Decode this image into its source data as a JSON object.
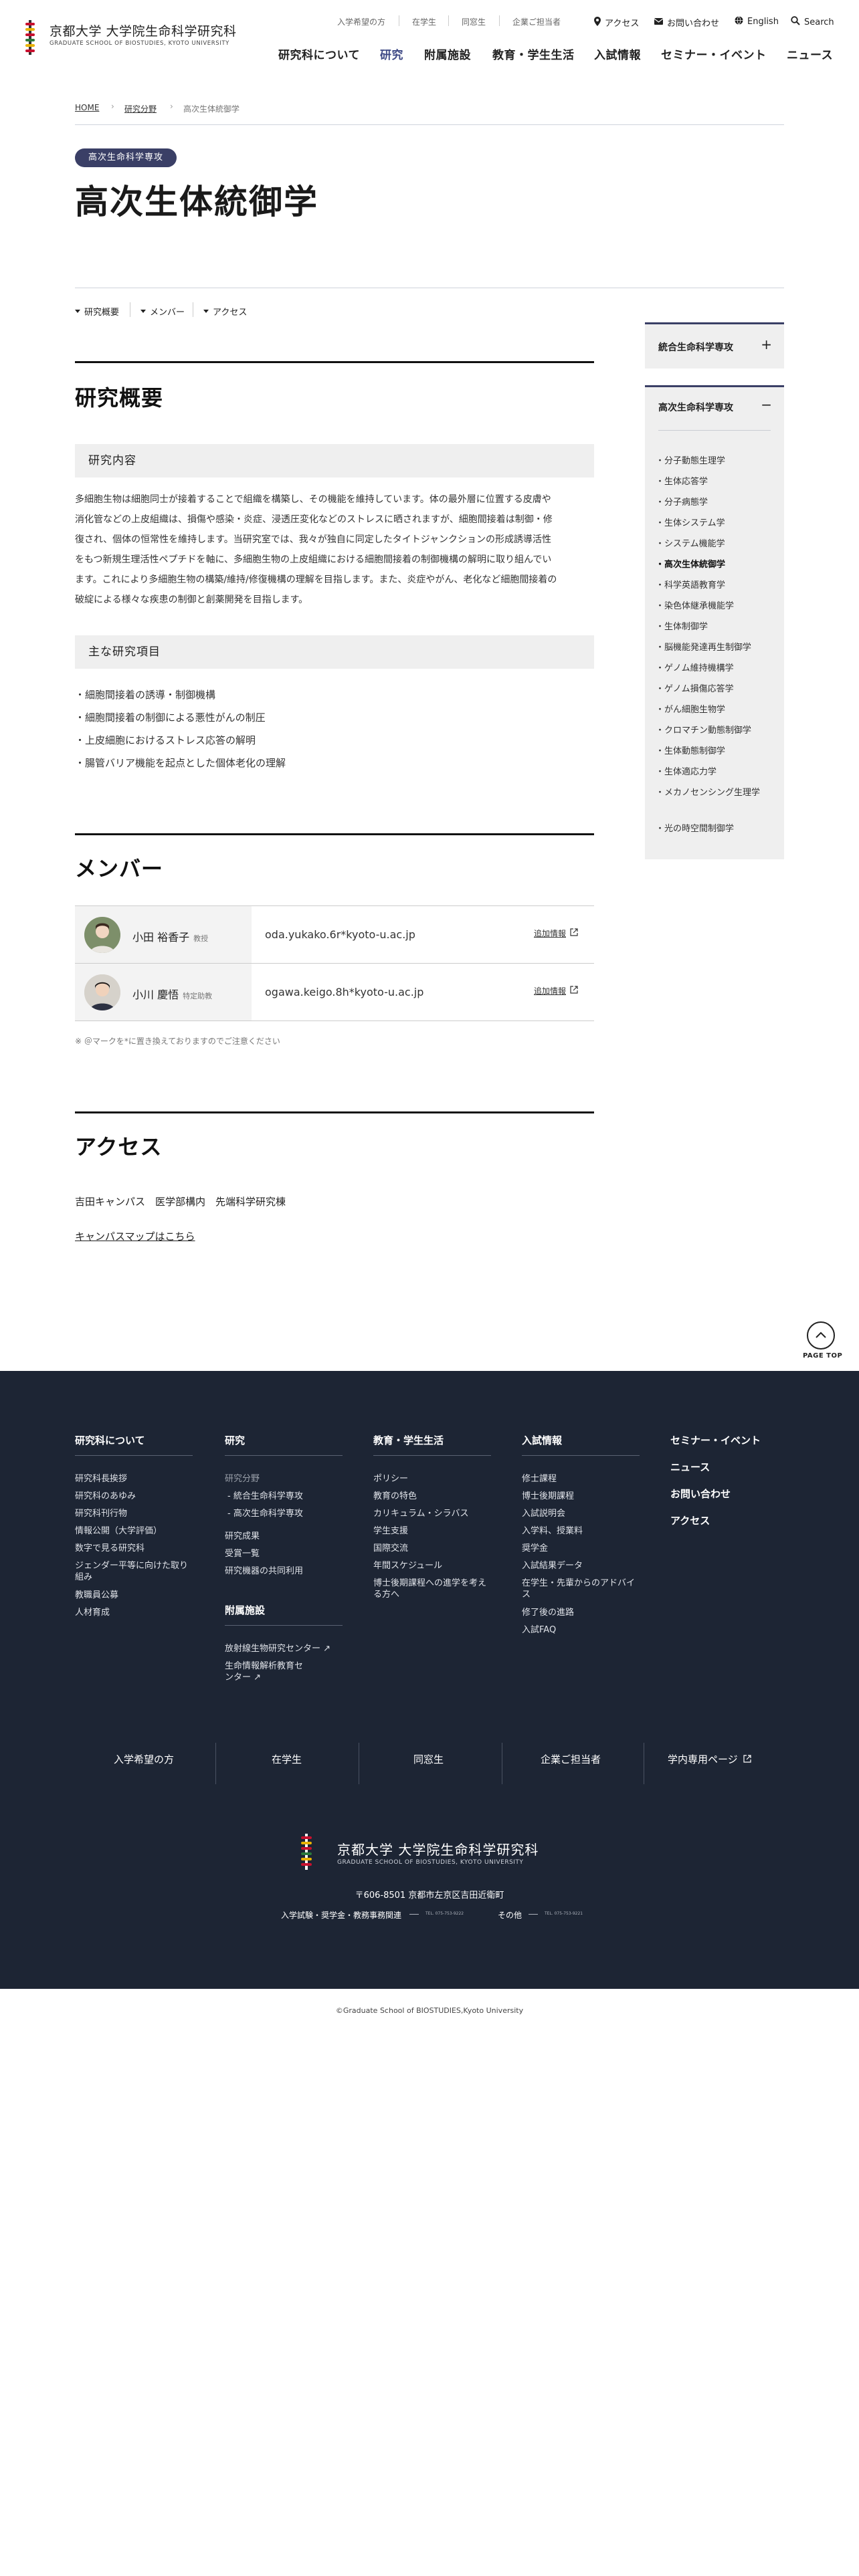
{
  "header": {
    "logo_jp": "京都大学 大学院生命科学研究科",
    "logo_en": "GRADUATE SCHOOL OF BIOSTUDIES, KYOTO UNIVERSITY",
    "utility_links": [
      "入学希望の方",
      "在学生",
      "同窓生",
      "企業ご担当者"
    ],
    "utility_actions": {
      "access": "アクセス",
      "contact": "お問い合わせ",
      "english": "English",
      "search": "Search"
    },
    "global_nav": [
      "研究科について",
      "研究",
      "附属施設",
      "教育・学生生活",
      "入試情報",
      "セミナー・イベント",
      "ニュース"
    ],
    "active_nav": "研究"
  },
  "breadcrumb": [
    "HOME",
    "研究分野",
    "高次生体統御学"
  ],
  "department_badge": "高次生命科学専攻",
  "page_title": "高次生体統御学",
  "anchor_links": [
    "研究概要",
    "メンバー",
    "アクセス"
  ],
  "overview": {
    "title": "研究概要",
    "content_heading": "研究内容",
    "content_lines": [
      "多細胞生物は細胞同士が接着することで組織を構築し、その機能を維持しています。体の最外層に位置する皮膚や",
      "消化管などの上皮組織は、損傷や感染・炎症、浸透圧変化などのストレスに晒されますが、細胞間接着は制御・修",
      "復され、個体の恒常性を維持します。当研究室では、我々が独自に同定したタイトジャンクションの形成誘導活性",
      "をもつ新規生理活性ペプチドを軸に、多細胞生物の上皮組織における細胞間接着の制御機構の解明に取り組んでい",
      "ます。これにより多細胞生物の構築/維持/修復機構の理解を目指します。また、炎症やがん、老化など細胞間接着の",
      "破綻による様々な疾患の制御と創薬開発を目指します。"
    ],
    "topics_heading": "主な研究項目",
    "topics": [
      "細胞間接着の誘導・制御機構",
      "細胞間接着の制御による悪性がんの制圧",
      "上皮細胞におけるストレス応答の解明",
      "腸管バリア機能を起点とした個体老化の理解"
    ]
  },
  "members": {
    "title": "メンバー",
    "rows": [
      {
        "name": "小田 裕香子",
        "role": "教授",
        "email": "oda.yukako.6r*kyoto-u.ac.jp",
        "link": "追加情報"
      },
      {
        "name": "小川 慶悟",
        "role": "特定助教",
        "email": "ogawa.keigo.8h*kyoto-u.ac.jp",
        "link": "追加情報"
      }
    ],
    "note": "※ ＠マークを*に置き換えておりますのでご注意ください"
  },
  "access": {
    "title": "アクセス",
    "location": "吉田キャンパス　医学部構内　先端科学研究棟",
    "map_link": "キャンパスマップはこちら"
  },
  "side_nav": {
    "collapsed_heading": "統合生命科学専攻",
    "expanded_heading": "高次生命科学専攻",
    "items": [
      "分子動態生理学",
      "生体応答学",
      "分子病態学",
      "生体システム学",
      "システム機能学",
      "高次生体統御学",
      "科学英語教育学",
      "染色体継承機能学",
      "生体制御学",
      "脳機能発達再生制御学",
      "ゲノム維持機構学",
      "ゲノム損傷応答学",
      "がん細胞生物学",
      "クロマチン動態制御学",
      "生体動態制御学",
      "生体適応力学",
      "メカノセンシング生理学",
      "光の時空間制御学"
    ],
    "active_item": "高次生体統御学"
  },
  "page_top": "PAGE TOP",
  "footer": {
    "columns": [
      {
        "heading": "研究科について",
        "links": [
          "研究科長挨拶",
          "研究科のあゆみ",
          "研究科刊行物",
          "情報公開（大学評価）",
          "数字で見る研究科",
          "ジェンダー平等に向けた取り組み",
          "教職員公募",
          "人材育成"
        ]
      },
      {
        "heading": "研究",
        "links": [
          "研究分野",
          "統合生命科学専攻",
          "高次生命科学専攻",
          "研究成果",
          "受賞一覧",
          "研究機器の共同利用"
        ],
        "subheading": "附属施設",
        "sublinks": [
          "放射線生物研究センター",
          "生命情報解析教育センター"
        ]
      },
      {
        "heading": "教育・学生生活",
        "links": [
          "ポリシー",
          "教育の特色",
          "カリキュラム・シラバス",
          "学生支援",
          "国際交流",
          "年間スケジュール",
          "博士後期課程への進学を考える方へ"
        ]
      },
      {
        "heading": "入試情報",
        "links": [
          "修士課程",
          "博士後期課程",
          "入試説明会",
          "入学料、授業料",
          "奨学金",
          "入試結果データ",
          "在学生・先輩からのアドバイス",
          "修了後の進路",
          "入試FAQ"
        ]
      }
    ],
    "solo_links": [
      "セミナー・イベント",
      "ニュース",
      "お問い合わせ",
      "アクセス"
    ],
    "audience_links": [
      "入学希望の方",
      "在学生",
      "同窓生",
      "企業ご担当者",
      "学内専用ページ"
    ],
    "logo_jp": "京都大学 大学院生命科学研究科",
    "logo_en": "GRADUATE SCHOOL OF BIOSTUDIES, KYOTO UNIVERSITY",
    "address": "〒606-8501 京都市左京区吉田近衛町",
    "contact_1": "入学試験・奨学金・教務事務関連",
    "contact_2": "その他",
    "tel_1": "TEL. 075-753-9222",
    "tel_2": "TEL. 075-753-9221"
  },
  "copyright": "©Graduate School of BIOSTUDIES,Kyoto University",
  "colors": {
    "accent": "#3a3f66",
    "footer_bg": "#1d2534",
    "subhead_bg": "#efefef"
  }
}
